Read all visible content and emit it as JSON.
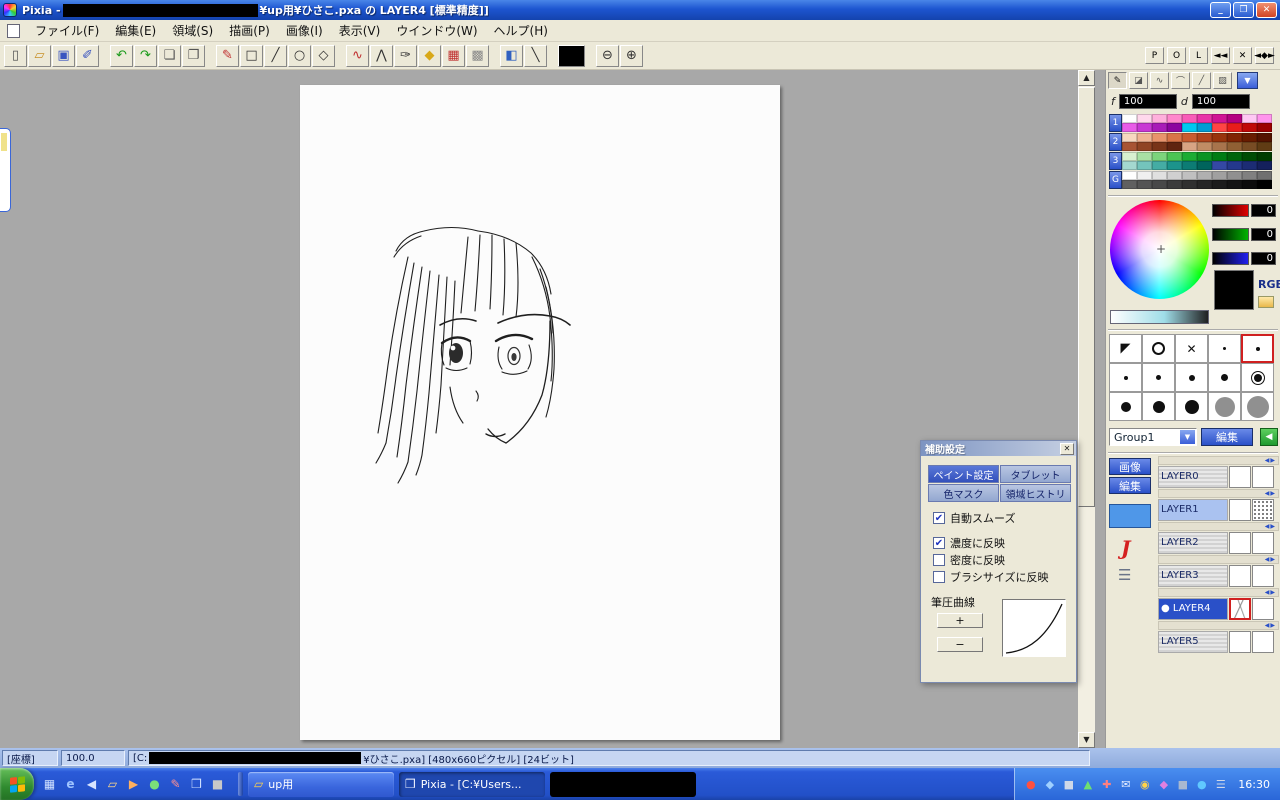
{
  "window": {
    "title_prefix": "Pixia - ",
    "title_suffix": "¥up用¥ひさこ.pxa の LAYER4 [標準精度]]",
    "controls": [
      {
        "name": "minimize",
        "glyph": "_"
      },
      {
        "name": "maximize",
        "glyph": "❐"
      },
      {
        "name": "close",
        "glyph": "✕"
      }
    ]
  },
  "menu": {
    "items": [
      {
        "key": "file",
        "label": "ファイル(F)"
      },
      {
        "key": "edit",
        "label": "編集(E)"
      },
      {
        "key": "region",
        "label": "領域(S)"
      },
      {
        "key": "draw",
        "label": "描画(P)"
      },
      {
        "key": "image",
        "label": "画像(I)"
      },
      {
        "key": "view",
        "label": "表示(V)"
      },
      {
        "key": "window",
        "label": "ウインドウ(W)"
      },
      {
        "key": "help",
        "label": "ヘルプ(H)"
      }
    ]
  },
  "toolbar": {
    "buttons": [
      {
        "name": "new-file",
        "glyph": "▯",
        "color": "#555555"
      },
      {
        "name": "open-file",
        "glyph": "▱",
        "color": "#c8922a"
      },
      {
        "name": "save-file",
        "glyph": "▣",
        "color": "#3a55c0"
      },
      {
        "name": "save-as",
        "glyph": "✐",
        "color": "#3a55c0"
      },
      {
        "name": "undo",
        "glyph": "↶",
        "color": "#1a9a1a",
        "gap": true
      },
      {
        "name": "redo",
        "glyph": "↷",
        "color": "#1a9a1a"
      },
      {
        "name": "copy",
        "glyph": "❏",
        "color": "#555555"
      },
      {
        "name": "paste",
        "glyph": "❐",
        "color": "#555555"
      },
      {
        "name": "pen-tool",
        "glyph": "✎",
        "color": "#c03030",
        "gap": true
      },
      {
        "name": "rect-tool",
        "glyph": "□",
        "color": "#333333"
      },
      {
        "name": "line-tool",
        "glyph": "╱",
        "color": "#333333"
      },
      {
        "name": "ellipse-tool",
        "glyph": "○",
        "color": "#333333"
      },
      {
        "name": "polygon-tool",
        "glyph": "◇",
        "color": "#333333"
      },
      {
        "name": "curve-tool",
        "glyph": "∿",
        "color": "#c03030",
        "gap": true
      },
      {
        "name": "polyline-tool",
        "glyph": "⋀",
        "color": "#333333"
      },
      {
        "name": "text-tool",
        "glyph": "✑",
        "color": "#333333"
      },
      {
        "name": "fill-tool",
        "glyph": "◆",
        "color": "#d8a818"
      },
      {
        "name": "pattern-tool",
        "glyph": "▦",
        "color": "#c03030"
      },
      {
        "name": "mask-pattern-tool",
        "glyph": "▩",
        "color": "#888888"
      },
      {
        "name": "gradient-tool",
        "glyph": "◧",
        "color": "#3060c0",
        "gap": true
      },
      {
        "name": "ruler-pen-tool",
        "glyph": "╲",
        "color": "#333333"
      },
      {
        "name": "current-color",
        "type": "swatch",
        "gap": true
      },
      {
        "name": "zoom-out-tool",
        "glyph": "⊖",
        "color": "#333333",
        "gap": true
      },
      {
        "name": "zoom-in-tool",
        "glyph": "⊕",
        "color": "#333333"
      }
    ],
    "right_buttons": [
      {
        "name": "panel-toggle-p",
        "label": "P"
      },
      {
        "name": "panel-toggle-o",
        "label": "O"
      },
      {
        "name": "panel-toggle-l",
        "label": "L"
      },
      {
        "name": "dock-left-button",
        "label": "◄◄"
      },
      {
        "name": "panel-close-button",
        "label": "✕"
      },
      {
        "name": "dock-split-button",
        "label": "◄◆►"
      }
    ]
  },
  "right_panel": {
    "tools": [
      {
        "name": "pen",
        "glyph": "✎",
        "color": "#111111",
        "selected": true
      },
      {
        "name": "brush",
        "glyph": "◪",
        "color": "#555555"
      },
      {
        "name": "curve",
        "glyph": "∿",
        "color": "#555555"
      },
      {
        "name": "arc",
        "glyph": "⌒",
        "color": "#555555"
      },
      {
        "name": "line",
        "glyph": "╱",
        "color": "#555555"
      },
      {
        "name": "spray",
        "glyph": "▨",
        "color": "#555555"
      }
    ],
    "tool_dropdown_glyph": "▼",
    "f_label": "f",
    "f_value": "100",
    "d_label": "d",
    "d_value": "100",
    "wheel_cursor_glyph": "+",
    "palette_groups": [
      {
        "label": "1",
        "colors": [
          "#ffffff",
          "#ffd8ec",
          "#ffb0dc",
          "#ff88cc",
          "#f85cb8",
          "#e834a8",
          "#d01494",
          "#b40080",
          "#ffc8f4",
          "#ff94ec",
          "#e85ce8",
          "#c838d4",
          "#a81cb8",
          "#8c04a0",
          "#00c8f0",
          "#009cd4",
          "#ff4444",
          "#e81c1c",
          "#c00808",
          "#9c0000"
        ]
      },
      {
        "label": "2",
        "colors": [
          "#f8d8c0",
          "#f0b494",
          "#e8946c",
          "#d87448",
          "#c85c30",
          "#b0441c",
          "#98340c",
          "#802404",
          "#681c00",
          "#541400",
          "#a85434",
          "#904424",
          "#783418",
          "#602410",
          "#d8a484",
          "#c08c64",
          "#a8744c",
          "#906034",
          "#784c24",
          "#603c14"
        ]
      },
      {
        "label": "3",
        "colors": [
          "#d8f0d0",
          "#a8e0a4",
          "#7cd47c",
          "#4cc454",
          "#1cac34",
          "#0c9424",
          "#007c14",
          "#00640c",
          "#004c04",
          "#003c00",
          "#a4d8d0",
          "#74c4bc",
          "#44aca4",
          "#1c948c",
          "#0c7c74",
          "#00645c",
          "#3448a4",
          "#24388c",
          "#1c2c74",
          "#14205c"
        ]
      },
      {
        "label": "G",
        "colors": [
          "#ffffff",
          "#f0f0f0",
          "#e0e0e0",
          "#d0d0d0",
          "#c0c0c0",
          "#b0b0b0",
          "#a0a0a0",
          "#909090",
          "#808080",
          "#707070",
          "#606060",
          "#545454",
          "#484848",
          "#3c3c3c",
          "#303030",
          "#262626",
          "#1c1c1c",
          "#141414",
          "#0c0c0c",
          "#000000"
        ]
      }
    ],
    "rgb": {
      "r": "0",
      "g": "0",
      "b": "0",
      "label": "RGB"
    },
    "brush_shapes": [
      {
        "kind": "arrow"
      },
      {
        "kind": "circle"
      },
      {
        "kind": "x"
      },
      {
        "kind": "dot",
        "size": 3
      },
      {
        "kind": "dot",
        "size": 4,
        "selected": true
      },
      {
        "kind": "dot",
        "size": 4
      },
      {
        "kind": "dot",
        "size": 5
      },
      {
        "kind": "dot",
        "size": 6
      },
      {
        "kind": "dot",
        "size": 7
      },
      {
        "kind": "dot",
        "size": 8,
        "ring": true
      },
      {
        "kind": "dot",
        "size": 10
      },
      {
        "kind": "dot",
        "size": 12
      },
      {
        "kind": "dot",
        "size": 14
      },
      {
        "kind": "dot",
        "size": 20,
        "color": "#909090"
      },
      {
        "kind": "dot",
        "size": 22,
        "color": "#909090"
      }
    ],
    "group_name": "Group1",
    "group_dropdown_glyph": "▼",
    "edit_label": "編集",
    "group_go_glyph": "◀",
    "layer_image_label": "画像",
    "layer_edit_label": "編集",
    "text_icon_glyph": "J",
    "list_icon_glyph": "☰",
    "layers": [
      {
        "name": "LAYER0",
        "thumbs": [
          "blank",
          "blank"
        ]
      },
      {
        "name": "LAYER1",
        "tinted": true,
        "thumbs": [
          "blank",
          "dots"
        ]
      },
      {
        "name": "LAYER2",
        "thumbs": [
          "blank",
          "blank"
        ]
      },
      {
        "name": "LAYER3",
        "thumbs": [
          "blank",
          "blank"
        ]
      },
      {
        "name": "LAYER4",
        "selected": true,
        "eye": true,
        "thumbs": [
          "sketch",
          "blank"
        ]
      },
      {
        "name": "LAYER5",
        "thumbs": [
          "blank",
          "blank"
        ]
      }
    ]
  },
  "aux_dialog": {
    "title": "補助設定",
    "close_glyph": "✕",
    "tabs": [
      {
        "label": "ペイント設定",
        "active": true
      },
      {
        "label": "タブレット",
        "active": false
      },
      {
        "label": "色マスク",
        "active": false
      },
      {
        "label": "領域ヒストリ",
        "active": false
      }
    ],
    "check_glyph": "✔",
    "checkboxes": [
      {
        "label": "自動スムーズ",
        "checked": true
      },
      {
        "label": "濃度に反映",
        "checked": true
      },
      {
        "label": "密度に反映",
        "checked": false
      },
      {
        "label": "ブラシサイズに反映",
        "checked": false
      }
    ],
    "curve_label": "筆圧曲線",
    "plus_label": "+",
    "minus_label": "−"
  },
  "workspace": {
    "scrollbar_up": "▲",
    "scrollbar_down": "▼"
  },
  "status_bar": {
    "coord": "[座標]",
    "zoom": "100.0",
    "file_prefix": "[C:",
    "file_suffix": "¥ひさこ.pxa] [480x660ピクセル] [24ビット]"
  },
  "taskbar": {
    "quick_launch": [
      {
        "name": "show-desktop-icon",
        "glyph": "▦",
        "color": "#cfe0ff"
      },
      {
        "name": "ie-icon",
        "glyph": "e",
        "color": "#9fc4ff"
      },
      {
        "name": "volume-icon",
        "glyph": "◀",
        "color": "#d8e4ff"
      },
      {
        "name": "folder-icon",
        "glyph": "▱",
        "color": "#ffd988"
      },
      {
        "name": "media-icon",
        "glyph": "▶",
        "color": "#ffb060"
      },
      {
        "name": "app-green-icon",
        "glyph": "●",
        "color": "#7ae07a"
      },
      {
        "name": "pencil-icon",
        "glyph": "✎",
        "color": "#ff9090"
      },
      {
        "name": "window-icon",
        "glyph": "❒",
        "color": "#d0e0ff"
      },
      {
        "name": "app-gray-icon",
        "glyph": "■",
        "color": "#c8c8c8"
      }
    ],
    "windows": [
      {
        "label": "up用",
        "icon": "folder",
        "icon_glyph": "▱",
        "icon_color": "#ffd34a",
        "active": false
      },
      {
        "label": "Pixia - [C:¥Users...",
        "icon": "pixia",
        "icon_glyph": "❒",
        "icon_color": "#eef2ff",
        "active": true
      },
      {
        "redacted": true
      }
    ],
    "tray_icons": [
      {
        "name": "antivirus-icon",
        "glyph": "●",
        "color": "#ff5040"
      },
      {
        "name": "security-icon",
        "glyph": "◆",
        "color": "#9fd0ff"
      },
      {
        "name": "display-icon",
        "glyph": "■",
        "color": "#cfd8e8"
      },
      {
        "name": "status-icon",
        "glyph": "▲",
        "color": "#70e070"
      },
      {
        "name": "health-icon",
        "glyph": "✚",
        "color": "#ff8080"
      },
      {
        "name": "mail-icon",
        "glyph": "✉",
        "color": "#e8eeff"
      },
      {
        "name": "update-icon",
        "glyph": "◉",
        "color": "#ffd34a"
      },
      {
        "name": "messenger-icon",
        "glyph": "◆",
        "color": "#e080e0"
      },
      {
        "name": "device-icon",
        "glyph": "■",
        "color": "#a8b8d0"
      },
      {
        "name": "network-icon",
        "glyph": "●",
        "color": "#60c8ff"
      },
      {
        "name": "ime-icon",
        "glyph": "☰",
        "color": "#d0d8e8"
      }
    ],
    "clock": "16:30"
  }
}
